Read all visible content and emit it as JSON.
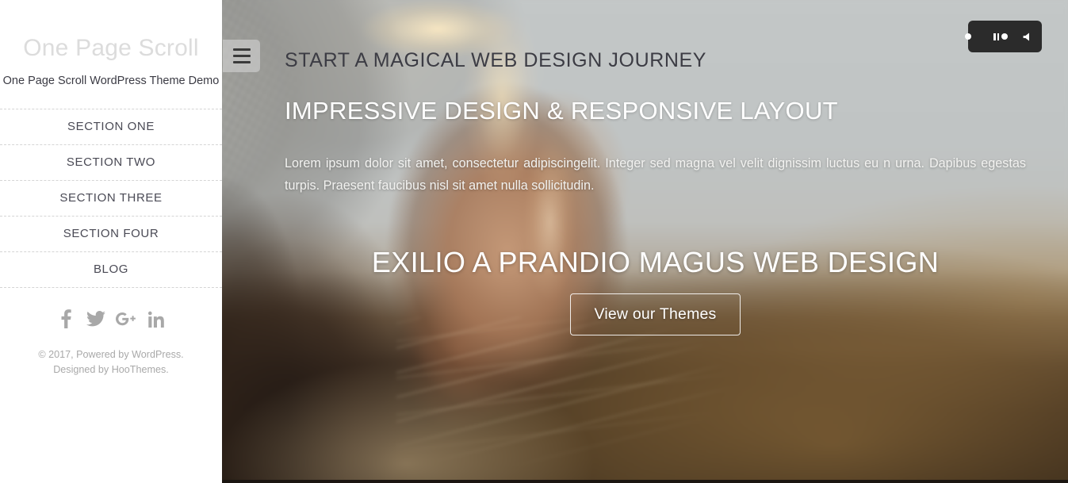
{
  "sidebar": {
    "site_title": "One Page Scroll",
    "site_description": "One Page Scroll WordPress Theme Demo",
    "nav_items": [
      {
        "label": "SECTION ONE"
      },
      {
        "label": "SECTION TWO"
      },
      {
        "label": "SECTION THREE"
      },
      {
        "label": "SECTION FOUR"
      },
      {
        "label": "BLOG"
      }
    ],
    "social": [
      {
        "name": "facebook-icon",
        "label": "Facebook"
      },
      {
        "name": "twitter-icon",
        "label": "Twitter"
      },
      {
        "name": "google-plus-icon",
        "label": "Google Plus"
      },
      {
        "name": "linkedin-icon",
        "label": "LinkedIn"
      }
    ],
    "copyright": "© 2017, Powered by WordPress. Designed by HooThemes."
  },
  "hero": {
    "eyebrow": "START A MAGICAL WEB DESIGN JOURNEY",
    "title": "IMPRESSIVE DESIGN & RESPONSIVE LAYOUT",
    "paragraph": "Lorem ipsum dolor sit amet, consectetur adipiscingelit. Integer sed magna vel velit dignissim luctus eu n urna. Dapibus egestas turpis. Praesent faucibus nisl sit amet nulla sollicitudin.",
    "big_heading": "EXILIO A PRANDIO MAGUS WEB DESIGN",
    "button_label": "View our Themes"
  },
  "controls": {
    "menu_toggle_name": "hamburger-icon",
    "pause_name": "pause-icon",
    "speaker_name": "speaker-icon"
  },
  "colors": {
    "sidebar_bg": "#ffffff",
    "site_title": "#dcdcdc",
    "nav_text": "#4a4a55",
    "eyebrow_text": "#3c3c44",
    "hero_text": "#ffffff",
    "controls_bg": "#2b2b2b",
    "social_icon": "#a8a8a8"
  }
}
